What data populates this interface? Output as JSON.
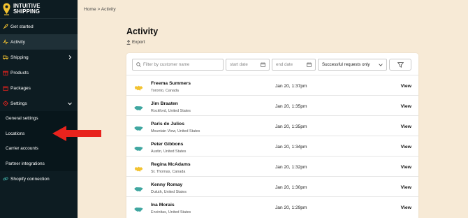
{
  "brand": {
    "line1": "INTUITIVE",
    "line2": "SHIPPING",
    "accent": "#f2c230"
  },
  "sidebar": {
    "items": [
      {
        "label": "Get started",
        "icon": "rocket-icon"
      },
      {
        "label": "Activity",
        "icon": "pulse-icon"
      },
      {
        "label": "Shipping",
        "icon": "truck-icon"
      },
      {
        "label": "Products",
        "icon": "gift-icon"
      },
      {
        "label": "Packages",
        "icon": "box-icon"
      },
      {
        "label": "Settings",
        "icon": "gear-icon"
      }
    ],
    "settings_sub": [
      "General settings",
      "Locations",
      "Carrier accounts",
      "Partner integrations"
    ],
    "shopify": {
      "label": "Shopify connection",
      "icon": "link-icon"
    }
  },
  "breadcrumb": {
    "home": "Home",
    "separator": ">",
    "current": "Activity"
  },
  "page": {
    "title": "Activity",
    "export_label": "Export"
  },
  "filters": {
    "search_placeholder": "Filter by customer name",
    "start_placeholder": "start date",
    "end_placeholder": "end date",
    "status_value": "Successful requests only"
  },
  "rows": [
    {
      "name": "Freema Summers",
      "location": "Toronto, Canada",
      "date": "Jan 20, 1:37pm",
      "action": "View",
      "flag": "canada"
    },
    {
      "name": "Jim Braaten",
      "location": "Rockford, United States",
      "date": "Jan 20, 1:35pm",
      "action": "View",
      "flag": "usa"
    },
    {
      "name": "Paris de Julios",
      "location": "Mountain View, United States",
      "date": "Jan 20, 1:35pm",
      "action": "View",
      "flag": "usa"
    },
    {
      "name": "Peter Gibbons",
      "location": "Austin, United States",
      "date": "Jan 20, 1:34pm",
      "action": "View",
      "flag": "usa"
    },
    {
      "name": "Regina McAdams",
      "location": "St. Thomas, Canada",
      "date": "Jan 20, 1:32pm",
      "action": "View",
      "flag": "canada"
    },
    {
      "name": "Kenny Romay",
      "location": "Duluth, United States",
      "date": "Jan 20, 1:30pm",
      "action": "View",
      "flag": "usa"
    },
    {
      "name": "Ina Morais",
      "location": "Encinitas, United States",
      "date": "Jan 20, 1:29pm",
      "action": "View",
      "flag": "usa"
    }
  ],
  "colors": {
    "sidebar_bg": "#0d1c22",
    "page_bg": "#f7ead6",
    "canada_map": "#f2c230",
    "usa_map": "#3fa6a0",
    "annotation_arrow": "#e8231d"
  }
}
